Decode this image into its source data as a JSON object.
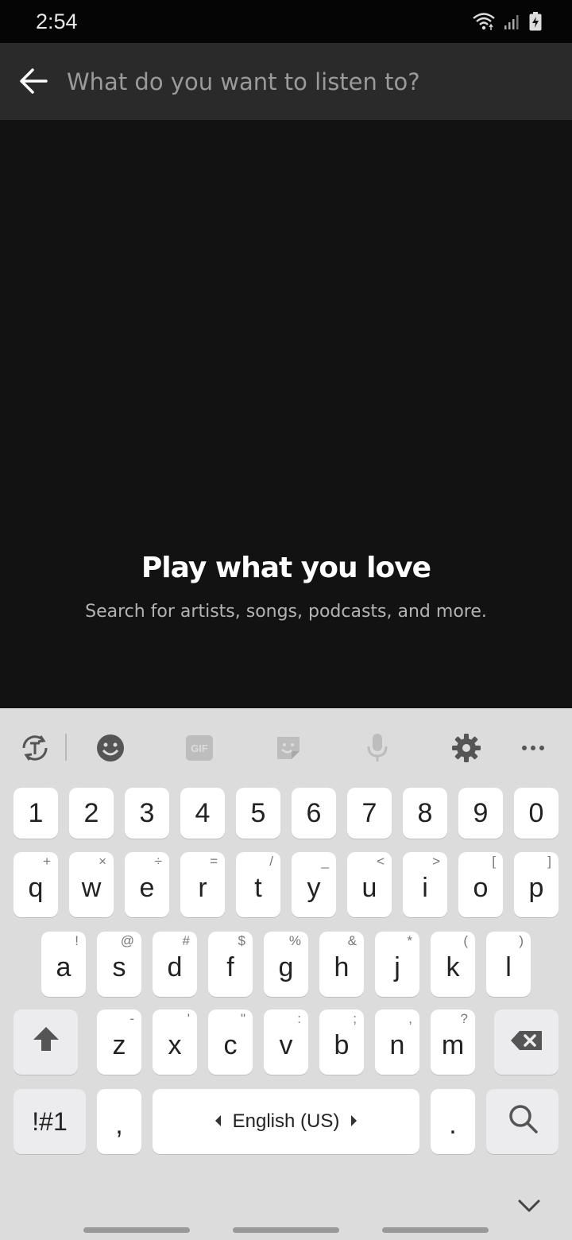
{
  "status": {
    "time": "2:54"
  },
  "search": {
    "placeholder": "What do you want to listen to?"
  },
  "empty_state": {
    "title": "Play what you love",
    "subtitle": "Search for artists, songs, podcasts, and more."
  },
  "keyboard": {
    "toolbar": [
      "translate-icon",
      "emoji-icon",
      "gif-icon",
      "sticker-icon",
      "mic-icon",
      "settings-icon",
      "more-icon"
    ],
    "gif_label": "GIF",
    "number_row": [
      "1",
      "2",
      "3",
      "4",
      "5",
      "6",
      "7",
      "8",
      "9",
      "0"
    ],
    "row1": [
      {
        "k": "q",
        "s": "+"
      },
      {
        "k": "w",
        "s": "×"
      },
      {
        "k": "e",
        "s": "÷"
      },
      {
        "k": "r",
        "s": "="
      },
      {
        "k": "t",
        "s": "/"
      },
      {
        "k": "y",
        "s": "_"
      },
      {
        "k": "u",
        "s": "<"
      },
      {
        "k": "i",
        "s": ">"
      },
      {
        "k": "o",
        "s": "["
      },
      {
        "k": "p",
        "s": "]"
      }
    ],
    "row2": [
      {
        "k": "a",
        "s": "!"
      },
      {
        "k": "s",
        "s": "@"
      },
      {
        "k": "d",
        "s": "#"
      },
      {
        "k": "f",
        "s": "$"
      },
      {
        "k": "g",
        "s": "%"
      },
      {
        "k": "h",
        "s": "&"
      },
      {
        "k": "j",
        "s": "*"
      },
      {
        "k": "k",
        "s": "("
      },
      {
        "k": "l",
        "s": ")"
      }
    ],
    "row3": [
      {
        "k": "z",
        "s": "-"
      },
      {
        "k": "x",
        "s": "'"
      },
      {
        "k": "c",
        "s": "\""
      },
      {
        "k": "v",
        "s": ":"
      },
      {
        "k": "b",
        "s": ";"
      },
      {
        "k": "n",
        "s": ","
      },
      {
        "k": "m",
        "s": "?"
      }
    ],
    "symbols_label": "!#1",
    "comma_label": ",",
    "space_label": "English (US)",
    "period_label": "."
  }
}
